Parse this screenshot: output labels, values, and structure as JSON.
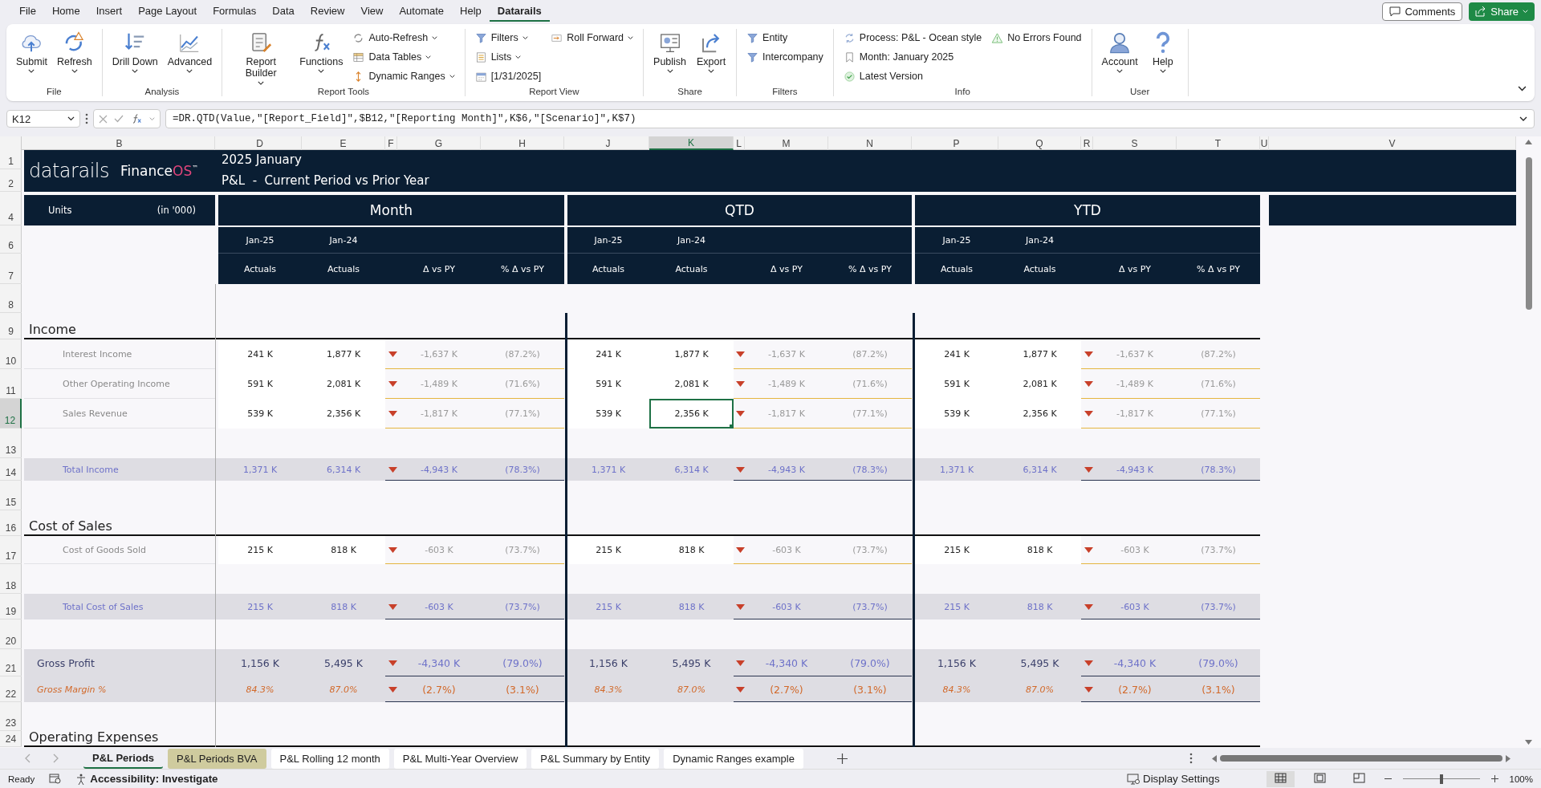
{
  "menu_tabs": [
    {
      "label": "File",
      "selected": false
    },
    {
      "label": "Home",
      "selected": false
    },
    {
      "label": "Insert",
      "selected": false
    },
    {
      "label": "Page Layout",
      "selected": false
    },
    {
      "label": "Formulas",
      "selected": false
    },
    {
      "label": "Data",
      "selected": false
    },
    {
      "label": "Review",
      "selected": false
    },
    {
      "label": "View",
      "selected": false
    },
    {
      "label": "Automate",
      "selected": false
    },
    {
      "label": "Help",
      "selected": false
    },
    {
      "label": "Datarails",
      "selected": true
    }
  ],
  "comments_button": "Comments",
  "share_button": "Share",
  "ribbon": {
    "groups": [
      {
        "label": "File",
        "items": [
          {
            "label": "Submit",
            "kind": "large",
            "dropdown": true
          },
          {
            "label": "Refresh",
            "kind": "large",
            "dropdown": true
          }
        ]
      },
      {
        "label": "Analysis",
        "items": [
          {
            "label": "Drill Down",
            "kind": "large",
            "dropdown": true
          },
          {
            "label": "Advanced",
            "kind": "large",
            "dropdown": true
          }
        ]
      },
      {
        "label": "Report Tools",
        "items": [
          {
            "label": "Report Builder",
            "kind": "large",
            "dropdown": true
          },
          {
            "label": "Functions",
            "kind": "large",
            "dropdown": true
          },
          {
            "label": "Auto-Refresh",
            "kind": "small",
            "dropdown": true
          },
          {
            "label": "Data Tables",
            "kind": "small",
            "dropdown": true
          },
          {
            "label": "Dynamic Ranges",
            "kind": "small",
            "dropdown": true
          }
        ]
      },
      {
        "label": "Report View",
        "items": [
          {
            "label": "Filters",
            "kind": "small",
            "dropdown": true
          },
          {
            "label": "Lists",
            "kind": "small",
            "dropdown": true
          },
          {
            "label": "[1/31/2025]",
            "kind": "small",
            "dropdown": false
          },
          {
            "label": "Roll Forward",
            "kind": "small",
            "dropdown": true
          }
        ]
      },
      {
        "label": "Share",
        "items": [
          {
            "label": "Publish",
            "kind": "large",
            "dropdown": true
          },
          {
            "label": "Export",
            "kind": "large",
            "dropdown": true
          }
        ]
      },
      {
        "label": "Filters",
        "items": [
          {
            "label": "Entity",
            "kind": "small",
            "dropdown": false
          },
          {
            "label": "Intercompany",
            "kind": "small",
            "dropdown": false
          }
        ]
      },
      {
        "label": "Info",
        "items": [
          {
            "label": "Process: P&L - Ocean style",
            "kind": "small",
            "dropdown": false
          },
          {
            "label": "Month: January 2025",
            "kind": "small",
            "dropdown": false
          },
          {
            "label": "Latest Version",
            "kind": "small",
            "dropdown": false
          },
          {
            "label": "No Errors Found",
            "kind": "small",
            "dropdown": false
          }
        ]
      },
      {
        "label": "User",
        "items": [
          {
            "label": "Account",
            "kind": "large",
            "dropdown": true
          },
          {
            "label": "Help",
            "kind": "large",
            "dropdown": true
          }
        ]
      }
    ]
  },
  "formula_bar": {
    "name_box": "K12",
    "formula": "=DR.QTD(Value,\"[Report_Field]\",$B12,\"[Reporting Month]\",K$6,\"[Scenario]\",K$7)"
  },
  "column_headers": [
    {
      "label": "B",
      "selected": false
    },
    {
      "label": "D",
      "selected": false
    },
    {
      "label": "E",
      "selected": false
    },
    {
      "label": "F",
      "selected": false
    },
    {
      "label": "G",
      "selected": false
    },
    {
      "label": "H",
      "selected": false
    },
    {
      "label": "J",
      "selected": false
    },
    {
      "label": "K",
      "selected": true
    },
    {
      "label": "L",
      "selected": false
    },
    {
      "label": "M",
      "selected": false
    },
    {
      "label": "N",
      "selected": false
    },
    {
      "label": "P",
      "selected": false
    },
    {
      "label": "Q",
      "selected": false
    },
    {
      "label": "R",
      "selected": false
    },
    {
      "label": "S",
      "selected": false
    },
    {
      "label": "T",
      "selected": false
    },
    {
      "label": "U",
      "selected": false
    },
    {
      "label": "V",
      "selected": false
    }
  ],
  "row_headers": [
    {
      "label": "1",
      "selected": false
    },
    {
      "label": "2",
      "selected": false
    },
    {
      "label": "4",
      "selected": false
    },
    {
      "label": "6",
      "selected": false
    },
    {
      "label": "7",
      "selected": false
    },
    {
      "label": "8",
      "selected": false
    },
    {
      "label": "9",
      "selected": false
    },
    {
      "label": "10",
      "selected": false
    },
    {
      "label": "11",
      "selected": false
    },
    {
      "label": "12",
      "selected": true
    },
    {
      "label": "13",
      "selected": false
    },
    {
      "label": "14",
      "selected": false
    },
    {
      "label": "15",
      "selected": false
    },
    {
      "label": "16",
      "selected": false
    },
    {
      "label": "17",
      "selected": false
    },
    {
      "label": "18",
      "selected": false
    },
    {
      "label": "19",
      "selected": false
    },
    {
      "label": "20",
      "selected": false
    },
    {
      "label": "21",
      "selected": false
    },
    {
      "label": "22",
      "selected": false
    },
    {
      "label": "23",
      "selected": false
    },
    {
      "label": "24",
      "selected": false
    }
  ],
  "report": {
    "logo": {
      "wordmark": "datarails",
      "product": "Finance",
      "product_accent": "OS",
      "trademark": "™"
    },
    "title": "2025 January",
    "subtitle": "P&L  -  Current Period vs Prior Year",
    "units_label": "Units",
    "units_value": "(in '000)",
    "blocks": [
      {
        "title": "Month",
        "periods": [
          "Jan-25",
          "Jan-24"
        ],
        "measures": [
          "Actuals",
          "Actuals",
          "Δ vs PY",
          "% Δ vs PY"
        ]
      },
      {
        "title": "QTD",
        "periods": [
          "Jan-25",
          "Jan-24"
        ],
        "measures": [
          "Actuals",
          "Actuals",
          "Δ vs PY",
          "% Δ vs PY"
        ]
      },
      {
        "title": "YTD",
        "periods": [
          "Jan-25",
          "Jan-24"
        ],
        "measures": [
          "Actuals",
          "Actuals",
          "Δ vs PY",
          "% Δ vs PY"
        ]
      }
    ],
    "rows": [
      {
        "kind": "blank"
      },
      {
        "kind": "section",
        "label": "Income"
      },
      {
        "kind": "line",
        "label": "Interest Income",
        "blocks": [
          {
            "values": [
              "241 K",
              "1,877 K",
              "-1,637 K",
              "(87.2%)"
            ],
            "declined": true
          },
          {
            "values": [
              "241 K",
              "1,877 K",
              "-1,637 K",
              "(87.2%)"
            ],
            "declined": true
          },
          {
            "values": [
              "241 K",
              "1,877 K",
              "-1,637 K",
              "(87.2%)"
            ],
            "declined": true
          }
        ]
      },
      {
        "kind": "line",
        "label": "Other Operating Income",
        "blocks": [
          {
            "values": [
              "591 K",
              "2,081 K",
              "-1,489 K",
              "(71.6%)"
            ],
            "declined": true
          },
          {
            "values": [
              "591 K",
              "2,081 K",
              "-1,489 K",
              "(71.6%)"
            ],
            "declined": true
          },
          {
            "values": [
              "591 K",
              "2,081 K",
              "-1,489 K",
              "(71.6%)"
            ],
            "declined": true
          }
        ]
      },
      {
        "kind": "line",
        "label": "Sales Revenue",
        "blocks": [
          {
            "values": [
              "539 K",
              "2,356 K",
              "-1,817 K",
              "(77.1%)"
            ],
            "declined": true
          },
          {
            "values": [
              "539 K",
              "2,356 K",
              "-1,817 K",
              "(77.1%)"
            ],
            "declined": true
          },
          {
            "values": [
              "539 K",
              "2,356 K",
              "-1,817 K",
              "(77.1%)"
            ],
            "declined": true
          }
        ]
      },
      {
        "kind": "blank"
      },
      {
        "kind": "total",
        "label": "Total Income",
        "blocks": [
          {
            "values": [
              "1,371 K",
              "6,314 K",
              "-4,943 K",
              "(78.3%)"
            ],
            "declined": true
          },
          {
            "values": [
              "1,371 K",
              "6,314 K",
              "-4,943 K",
              "(78.3%)"
            ],
            "declined": true
          },
          {
            "values": [
              "1,371 K",
              "6,314 K",
              "-4,943 K",
              "(78.3%)"
            ],
            "declined": true
          }
        ]
      },
      {
        "kind": "blank"
      },
      {
        "kind": "section",
        "label": "Cost of Sales"
      },
      {
        "kind": "line",
        "label": "Cost of Goods Sold",
        "blocks": [
          {
            "values": [
              "215 K",
              "818 K",
              "-603 K",
              "(73.7%)"
            ],
            "declined": true
          },
          {
            "values": [
              "215 K",
              "818 K",
              "-603 K",
              "(73.7%)"
            ],
            "declined": true
          },
          {
            "values": [
              "215 K",
              "818 K",
              "-603 K",
              "(73.7%)"
            ],
            "declined": true
          }
        ]
      },
      {
        "kind": "blank"
      },
      {
        "kind": "total",
        "label": "Total Cost of Sales",
        "blocks": [
          {
            "values": [
              "215 K",
              "818 K",
              "-603 K",
              "(73.7%)"
            ],
            "declined": true
          },
          {
            "values": [
              "215 K",
              "818 K",
              "-603 K",
              "(73.7%)"
            ],
            "declined": true
          },
          {
            "values": [
              "215 K",
              "818 K",
              "-603 K",
              "(73.7%)"
            ],
            "declined": true
          }
        ]
      },
      {
        "kind": "blank"
      },
      {
        "kind": "gross",
        "label": "Gross Profit",
        "blocks": [
          {
            "values": [
              "1,156 K",
              "5,495 K",
              "-4,340 K",
              "(79.0%)"
            ],
            "declined": true
          },
          {
            "values": [
              "1,156 K",
              "5,495 K",
              "-4,340 K",
              "(79.0%)"
            ],
            "declined": true
          },
          {
            "values": [
              "1,156 K",
              "5,495 K",
              "-4,340 K",
              "(79.0%)"
            ],
            "declined": true
          }
        ]
      },
      {
        "kind": "margin",
        "label": "Gross Margin %",
        "blocks": [
          {
            "values": [
              "84.3%",
              "87.0%",
              "(2.7%)",
              "(3.1%)"
            ],
            "declined": true
          },
          {
            "values": [
              "84.3%",
              "87.0%",
              "(2.7%)",
              "(3.1%)"
            ],
            "declined": true
          },
          {
            "values": [
              "84.3%",
              "87.0%",
              "(2.7%)",
              "(3.1%)"
            ],
            "declined": true
          }
        ]
      },
      {
        "kind": "blank"
      },
      {
        "kind": "section",
        "label": "Operating Expenses"
      }
    ]
  },
  "sheet_tabs": [
    {
      "label": "P&L Periods",
      "selected": true
    },
    {
      "label": "P&L Periods BVA",
      "selected": false,
      "color": "#cfcb9e"
    },
    {
      "label": "P&L Rolling 12 month",
      "selected": false
    },
    {
      "label": "P&L Multi-Year Overview",
      "selected": false
    },
    {
      "label": "P&L Summary by Entity",
      "selected": false
    },
    {
      "label": "Dynamic Ranges example",
      "selected": false
    }
  ],
  "status_bar": {
    "ready": "Ready",
    "accessibility": "Accessibility: Investigate",
    "display_settings": "Display Settings",
    "views": [
      {
        "selected": true
      },
      {
        "selected": false
      },
      {
        "selected": false
      }
    ],
    "zoom": {
      "level": 0.5,
      "label": "100%"
    }
  }
}
